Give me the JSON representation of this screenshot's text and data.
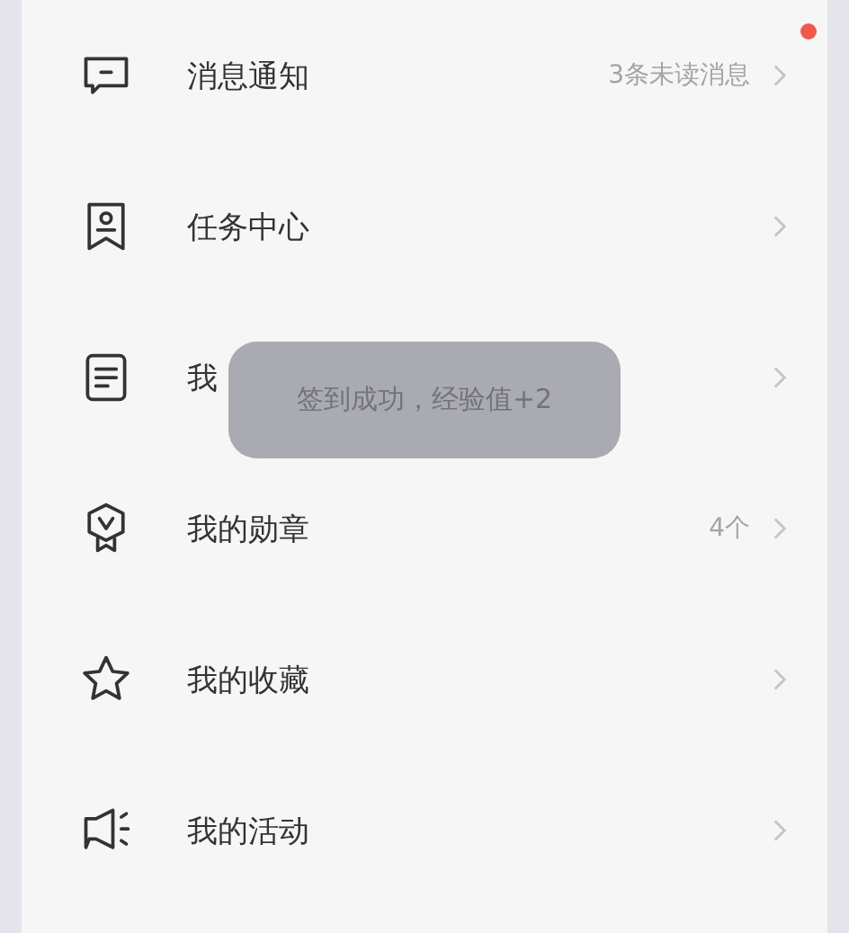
{
  "menu": [
    {
      "label": "消息通知",
      "value": "3条未读消息"
    },
    {
      "label": "任务中心"
    },
    {
      "label": "我"
    },
    {
      "label": "我的勋章",
      "value": "4个"
    },
    {
      "label": "我的收藏"
    },
    {
      "label": "我的活动"
    }
  ],
  "toast": {
    "text": "签到成功，经验值+2"
  }
}
